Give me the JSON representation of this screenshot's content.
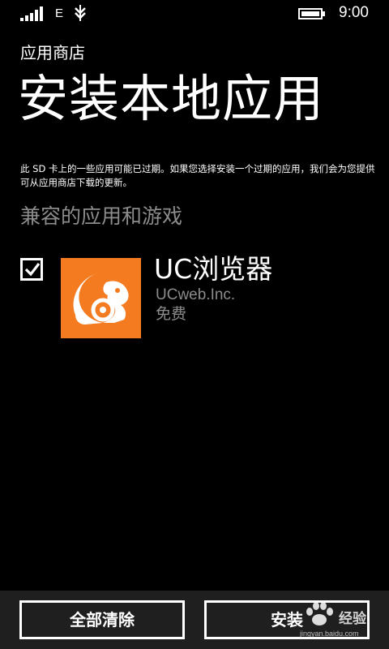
{
  "status_bar": {
    "network": "E",
    "time": "9:00",
    "icons": [
      "signal-icon",
      "data-connection-icon",
      "battery-icon"
    ]
  },
  "header": {
    "app_title": "应用商店",
    "page_title": "安装本地应用"
  },
  "notice": "此 SD 卡上的一些应用可能已过期。如果您选择安装一个过期的应用，我们会为您提供可从应用商店下载的更新。",
  "section_header": "兼容的应用和游戏",
  "apps": [
    {
      "name": "UC浏览器",
      "publisher": "UCweb.Inc.",
      "price": "免费",
      "checked": true,
      "icon": "uc-squirrel-icon",
      "icon_color": "#f47b1f"
    }
  ],
  "app_bar": {
    "clear_all_label": "全部清除",
    "install_label": "安装"
  },
  "watermark": {
    "text": "经验",
    "url": "jingyan.baidu.com"
  },
  "colors": {
    "background": "#000000",
    "text": "#ffffff",
    "subtle_text": "#8c8c8c",
    "app_bar": "#1f1f1f"
  }
}
